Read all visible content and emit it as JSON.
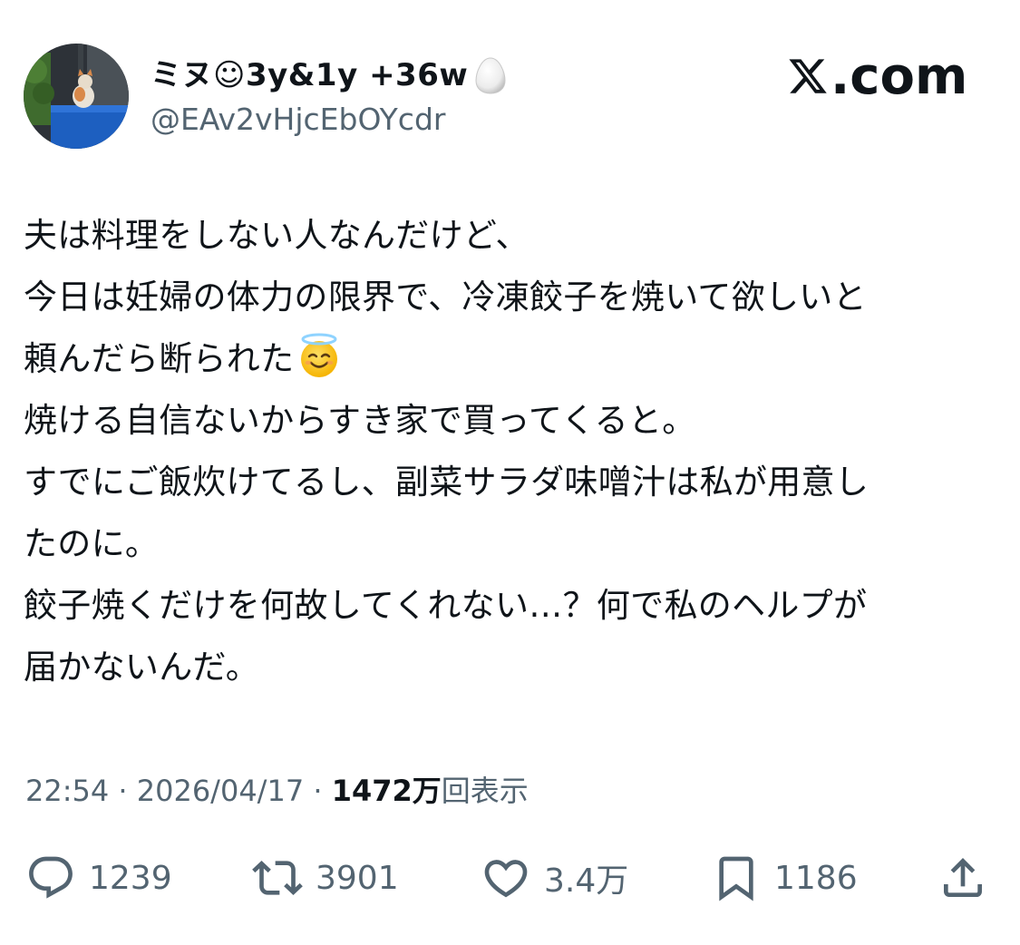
{
  "author": {
    "display_name": "ミヌ☺3y&1y +36w",
    "handle": "@EAv2vHjcEbOYcdr"
  },
  "brand": {
    "label": ".com"
  },
  "post": {
    "lines": [
      "夫は料理をしない人なんだけど、",
      "今日は妊婦の体力の限界で、冷凍餃子を焼いて欲しいと",
      "頼んだら断られた",
      "焼ける自信ないからすき家で買ってくると。",
      "すでにご飯炊けてるし、副菜サラダ味噌汁は私が用意し",
      "たのに。",
      "餃子焼くだけを何故してくれない…？何で私のヘルプが",
      "届かないんだ。"
    ],
    "emoji": "smiling-face-with-halo"
  },
  "meta": {
    "time": "22:54",
    "separator": " · ",
    "date": "2026/04/17",
    "views_count": "1472万",
    "views_label": "回表示"
  },
  "actions": {
    "replies": "1239",
    "reposts": "3901",
    "likes": "3.4万",
    "bookmarks": "1186"
  },
  "icons": {
    "reply": "speech-bubble-icon",
    "repost": "repost-arrows-icon",
    "like": "heart-icon",
    "bookmark": "bookmark-icon",
    "share": "share-upload-icon",
    "brand": "x-logo-icon"
  },
  "colors": {
    "text": "#0f1419",
    "secondary": "#536471"
  }
}
